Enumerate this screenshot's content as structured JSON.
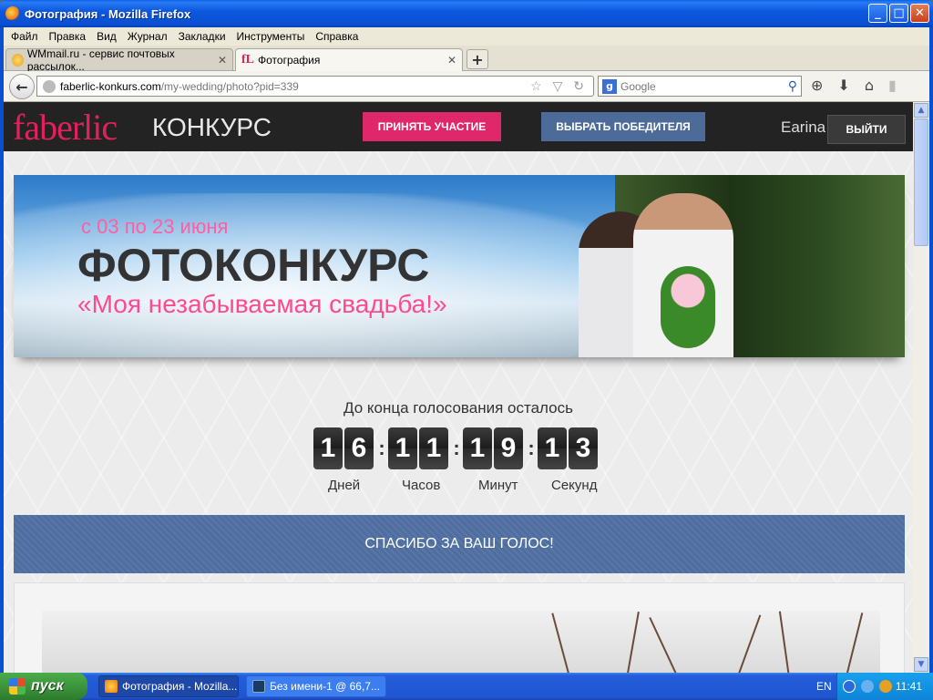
{
  "window": {
    "title": "Фотография - Mozilla Firefox",
    "min": "_",
    "max": "□",
    "close": "✕"
  },
  "menu": [
    "Файл",
    "Правка",
    "Вид",
    "Журнал",
    "Закладки",
    "Инструменты",
    "Справка"
  ],
  "tabs": [
    {
      "label": "WMmail.ru - сервис почтовых рассылок...",
      "close": "✕"
    },
    {
      "label": "Фотография",
      "close": "✕",
      "icon": "fL"
    }
  ],
  "new_tab": "+",
  "nav": {
    "back": "←",
    "url_host": "faberlic-konkurs.com",
    "url_path": "/my-wedding/photo?pid=339",
    "url_icons": "☆ ▽ ↻",
    "search_engine": "g",
    "search_placeholder": "Google",
    "search_go": "⚲",
    "toolbar_icons": [
      "⊕",
      "⬇",
      "⌂",
      "▮"
    ]
  },
  "site": {
    "logo": "faberlic",
    "logo_suffix": "КОНКУРС",
    "btn_participate": "ПРИНЯТЬ УЧАСТИЕ",
    "btn_choose_winner": "ВЫБРАТЬ ПОБЕДИТЕЛЯ",
    "username": "Earina",
    "btn_logout": "ВЫЙТИ"
  },
  "banner": {
    "dates": "с 03 по 23 июня",
    "title": "ФОТОКОНКУРС",
    "subtitle": "«Моя незабываемая свадьба!»"
  },
  "countdown": {
    "label": "До конца голосования осталось",
    "days": [
      "1",
      "6"
    ],
    "hours": [
      "1",
      "1"
    ],
    "minutes": [
      "1",
      "9"
    ],
    "seconds": [
      "1",
      "3"
    ],
    "separator": ":",
    "units": {
      "days": "Дней",
      "hours": "Часов",
      "minutes": "Минут",
      "seconds": "Секунд"
    }
  },
  "thanks_message": "СПАСИБО ЗА ВАШ ГОЛОС!",
  "taskbar": {
    "start": "пуск",
    "tasks": [
      {
        "label": "Фотография - Mozilla..."
      },
      {
        "label": "Без имени-1 @ 66,7..."
      }
    ],
    "lang": "EN",
    "clock": "11:41"
  },
  "colors": {
    "accent_pink": "#e0276a",
    "accent_blue": "#4d6b99",
    "header_bg": "#232323",
    "thanks_bg": "#4f6ea0"
  }
}
